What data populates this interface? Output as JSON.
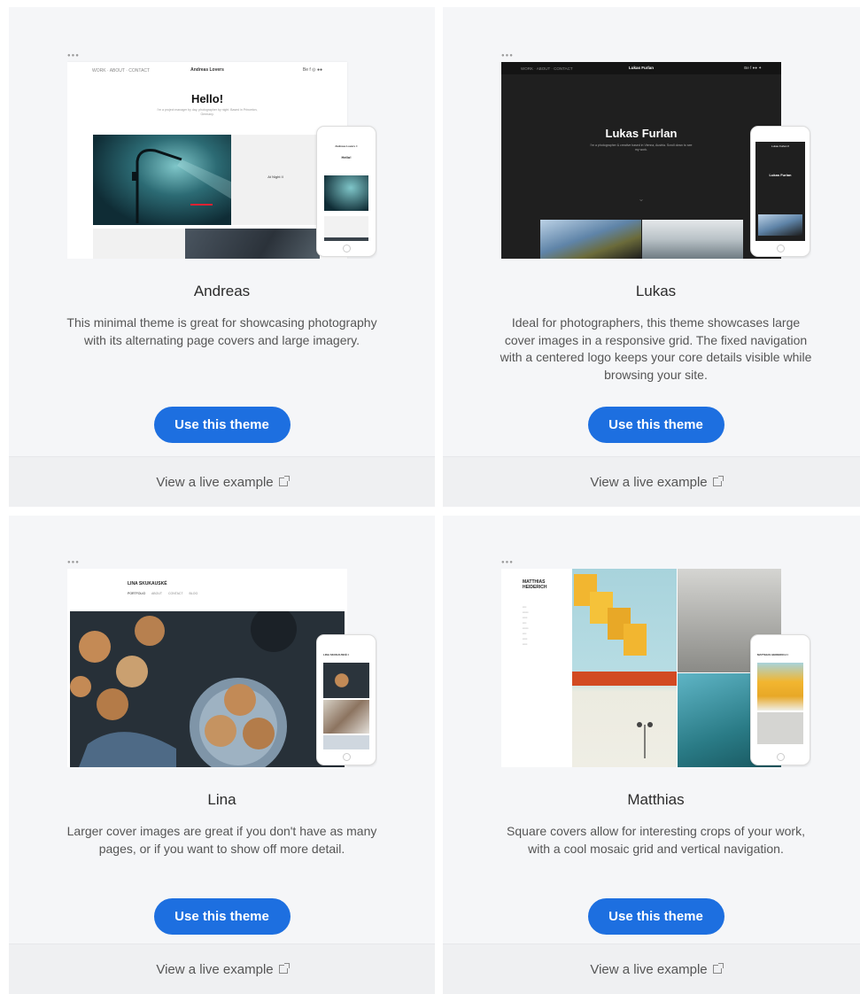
{
  "themes": [
    {
      "name": "Andreas",
      "description": "This minimal theme is great for showcasing photography with its alternating page covers and large imagery.",
      "cta": "Use this theme",
      "live_link": "View a live example",
      "preview": {
        "site_title": "Andreas Lovers",
        "headline": "Hello!",
        "tagline": "I'm a project manager by day, photographer by night. Based in Princeton, Germany.",
        "caption": "At Night II"
      }
    },
    {
      "name": "Lukas",
      "description": "Ideal for photographers, this theme showcases large cover images in a responsive grid. The fixed navigation with a centered logo keeps your core details visible while browsing your site.",
      "cta": "Use this theme",
      "live_link": "View a live example",
      "preview": {
        "site_title": "Lukas Furlan",
        "headline": "Lukas Furlan",
        "tagline": "I'm a photographer & creative based in Vienna, Austria. Scroll down to see my work."
      }
    },
    {
      "name": "Lina",
      "description": "Larger cover images are great if you don't have as many pages, or if you want to show off more detail.",
      "cta": "Use this theme",
      "live_link": "View a live example",
      "preview": {
        "site_title": "LINA SKUKAUSKÉ",
        "nav": [
          "PORTFOLIO",
          "ABOUT",
          "CONTACT",
          "BLOG"
        ]
      }
    },
    {
      "name": "Matthias",
      "description": "Square covers allow for interesting crops of your work, with a cool mosaic grid and vertical navigation.",
      "cta": "Use this theme",
      "live_link": "View a live example",
      "preview": {
        "site_title": "MATTHIAS HEIDERICH"
      }
    }
  ],
  "colors": {
    "accent": "#1d6fe0",
    "card_bg": "#f5f6f8",
    "footer_bg": "#eff0f2"
  }
}
